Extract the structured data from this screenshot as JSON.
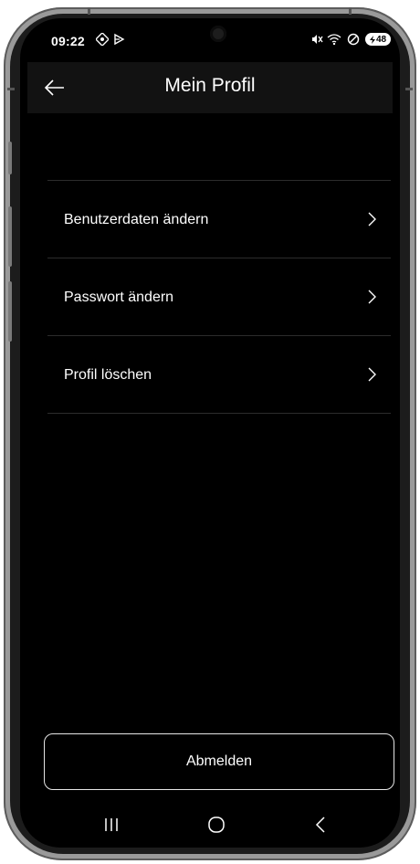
{
  "status_bar": {
    "time": "09:22",
    "battery": "48",
    "icons": [
      "nfc-icon",
      "play-icon",
      "mute-icon",
      "wifi-icon",
      "dnd-icon",
      "battery-icon"
    ]
  },
  "app_bar": {
    "title": "Mein Profil",
    "back_icon": "arrow-left-icon"
  },
  "menu": {
    "items": [
      {
        "label": "Benutzerdaten ändern"
      },
      {
        "label": "Passwort ändern"
      },
      {
        "label": "Profil löschen"
      }
    ]
  },
  "logout": {
    "label": "Abmelden"
  },
  "nav_bar": {
    "buttons": [
      "recents-icon",
      "home-icon",
      "back-icon"
    ]
  },
  "colors": {
    "background": "#000000",
    "app_bar": "#121212",
    "divider": "#2c2c2c",
    "text": "#ffffff"
  }
}
